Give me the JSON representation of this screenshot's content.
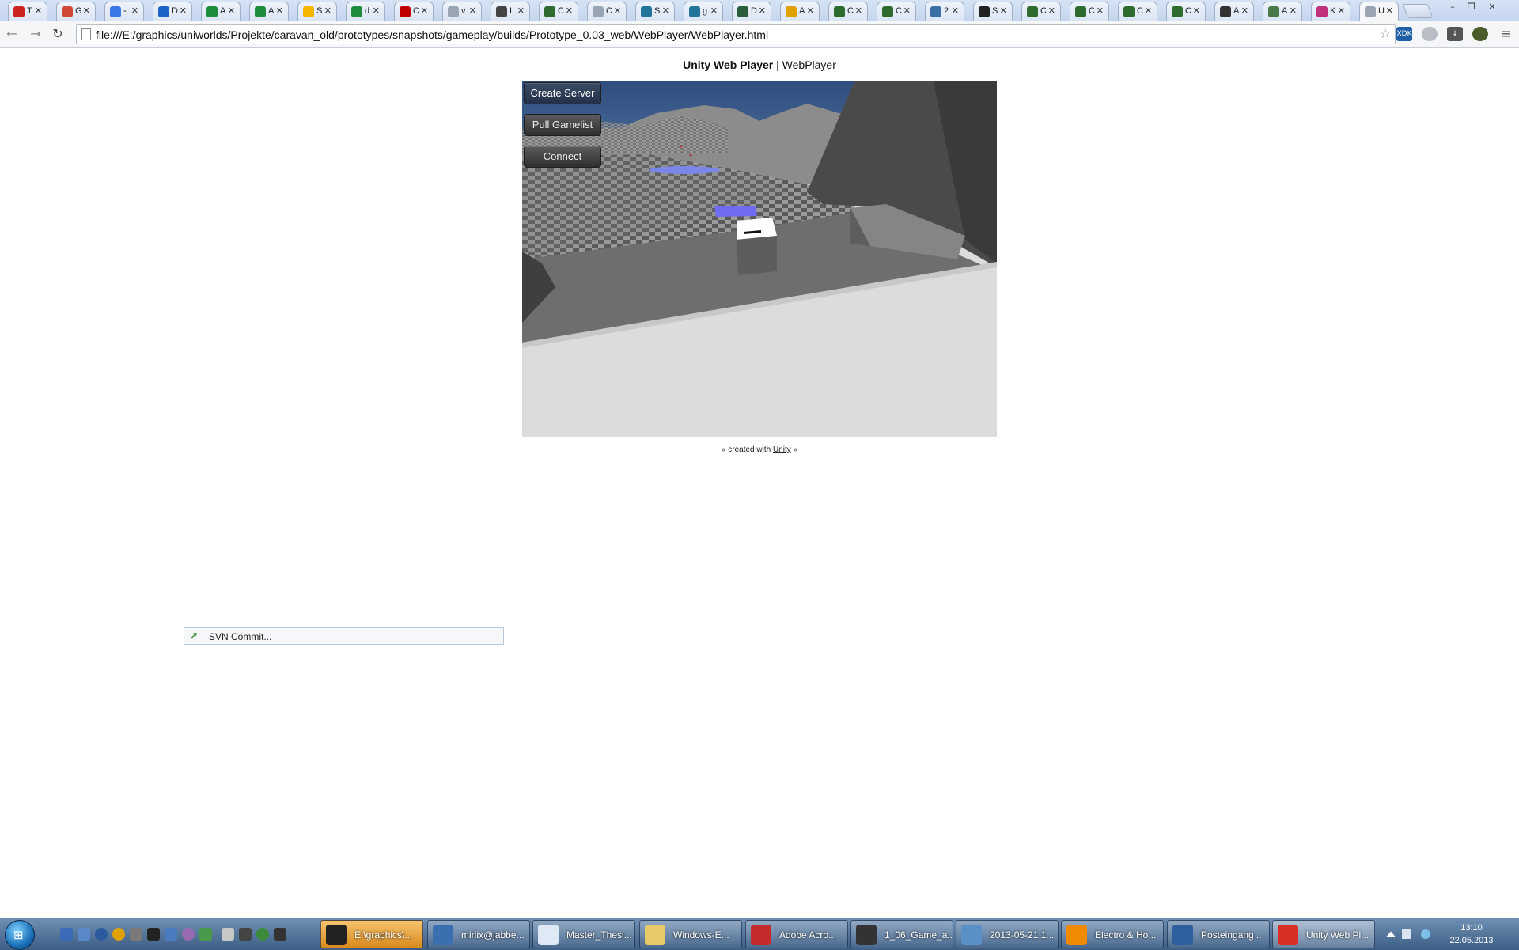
{
  "browser": {
    "tabs": [
      {
        "title": "T",
        "favicon": "opera-icon",
        "color": "#cc2222"
      },
      {
        "title": "G",
        "favicon": "google-plus-icon",
        "color": "#d14836"
      },
      {
        "title": "-",
        "favicon": "calendar-icon",
        "color": "#3b78e7"
      },
      {
        "title": "D",
        "favicon": "dropbox-icon",
        "color": "#1c63c8"
      },
      {
        "title": "A",
        "favicon": "sheets-icon",
        "color": "#1e8e3e"
      },
      {
        "title": "A",
        "favicon": "sheets-icon",
        "color": "#1e8e3e"
      },
      {
        "title": "S",
        "favicon": "drive-icon",
        "color": "#f4b400"
      },
      {
        "title": "d",
        "favicon": "sheets-icon",
        "color": "#1e8e3e"
      },
      {
        "title": "C",
        "favicon": "record-icon",
        "color": "#c00000"
      },
      {
        "title": "v",
        "favicon": "page-icon",
        "color": "#9aa5b3"
      },
      {
        "title": "I",
        "favicon": "face-icon",
        "color": "#444444"
      },
      {
        "title": "C",
        "favicon": "hex-icon",
        "color": "#2e6b2e"
      },
      {
        "title": "C",
        "favicon": "page-icon",
        "color": "#9aa5b3"
      },
      {
        "title": "S",
        "favicon": "wordpress-icon",
        "color": "#21759b"
      },
      {
        "title": "g",
        "favicon": "wordpress-icon",
        "color": "#21759b"
      },
      {
        "title": "D",
        "favicon": "d-icon",
        "color": "#2a5d3a"
      },
      {
        "title": "A",
        "favicon": "chrome-icon",
        "color": "#e0a000"
      },
      {
        "title": "C",
        "favicon": "hex-icon",
        "color": "#2e6b2e"
      },
      {
        "title": "C",
        "favicon": "hex-icon",
        "color": "#2e6b2e"
      },
      {
        "title": "2",
        "favicon": "bird-icon",
        "color": "#3a6ea5"
      },
      {
        "title": "S",
        "favicon": "eye-icon",
        "color": "#222222"
      },
      {
        "title": "C",
        "favicon": "hex-icon",
        "color": "#2e6b2e"
      },
      {
        "title": "C",
        "favicon": "hex-icon",
        "color": "#2e6b2e"
      },
      {
        "title": "C",
        "favicon": "hex-icon",
        "color": "#2e6b2e"
      },
      {
        "title": "C",
        "favicon": "hex-icon",
        "color": "#2e6b2e"
      },
      {
        "title": "A",
        "favicon": "penguin-icon",
        "color": "#333333"
      },
      {
        "title": "A",
        "favicon": "image-icon",
        "color": "#4a7a4a"
      },
      {
        "title": "K",
        "favicon": "k-icon",
        "color": "#c0307a"
      },
      {
        "title": "U",
        "favicon": "page-icon",
        "color": "#9aa5b3",
        "active": true
      }
    ],
    "url": "file:///E:/graphics/uniworlds/Projekte/caravan_old/prototypes/snapshots/gameplay/builds/Prototype_0.03_web/WebPlayer/WebPlayer.html"
  },
  "page": {
    "heading_bold": "Unity Web Player",
    "heading_sep": " | ",
    "heading_rest": "WebPlayer",
    "footer_prefix": "« created with ",
    "footer_link": "Unity",
    "footer_suffix": " »"
  },
  "game": {
    "buttons": [
      "Create Server",
      "Pull Gamelist",
      "Connect"
    ]
  },
  "svn_popup": {
    "label": "SVN Commit..."
  },
  "taskbar": {
    "items": [
      {
        "label": "E:\\graphics\\...",
        "icon": "xyplorer-icon",
        "color": "#222222"
      },
      {
        "label": "mirlix@jabbe...",
        "icon": "jabber-icon",
        "color": "#3a6fb0"
      },
      {
        "label": "Master_Thesi...",
        "icon": "odt-document-icon",
        "color": "#dfe8f5"
      },
      {
        "label": "Windows-E...",
        "icon": "folder-icon",
        "color": "#e8c96a"
      },
      {
        "label": "Adobe Acro...",
        "icon": "acrobat-icon",
        "color": "#c62b2b"
      },
      {
        "label": "1_06_Game_a...",
        "icon": "inkscape-icon",
        "color": "#333333"
      },
      {
        "label": "2013-05-21 1...",
        "icon": "image-viewer-icon",
        "color": "#5a8fc8"
      },
      {
        "label": "Electro & Ho...",
        "icon": "vlc-icon",
        "color": "#f08a00"
      },
      {
        "label": "Posteingang ...",
        "icon": "thunderbird-icon",
        "color": "#2f5f9e"
      },
      {
        "label": "Unity Web Pl...",
        "icon": "chrome-icon",
        "color": "#d93025"
      }
    ],
    "time": "13:10",
    "date": "22.05.2013"
  }
}
